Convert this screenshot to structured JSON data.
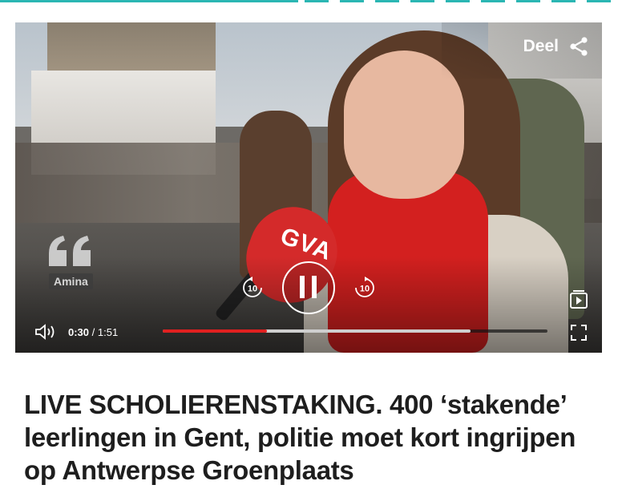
{
  "colors": {
    "accent_teal": "#2bb6b3",
    "progress_red": "#e02020",
    "headline_text": "#1e1e1e"
  },
  "video": {
    "share_label": "Deel",
    "speaker_name": "Amina",
    "mic_brand": "GVA",
    "current_time": "0:30",
    "separator": "/",
    "duration": "1:51",
    "progress_fraction": 0.27,
    "buffered_fraction": 0.8,
    "rewind_seconds": "10",
    "forward_seconds": "10",
    "icons": {
      "share": "share-icon",
      "quote": "quote-icon",
      "rewind": "rewind-10-icon",
      "pause": "pause-icon",
      "forward": "forward-10-icon",
      "playlist": "playlist-icon",
      "volume": "volume-icon",
      "fullscreen": "fullscreen-icon"
    }
  },
  "article": {
    "headline": "LIVE SCHOLIERENSTAKING. 400 ‘stakende’ leerlingen in Gent, politie moet kort ingrijpen op Antwerpse Groenplaats"
  }
}
